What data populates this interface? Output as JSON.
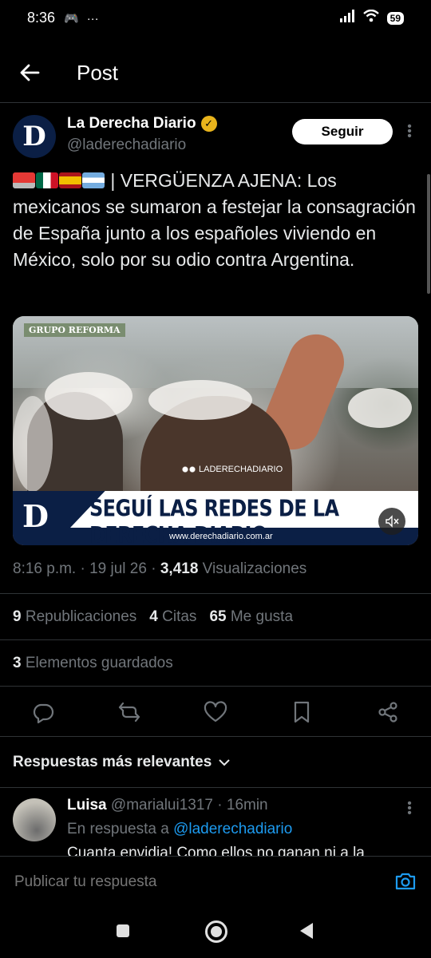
{
  "status_bar": {
    "time": "8:36",
    "extra": "···",
    "battery": "59"
  },
  "header": {
    "title": "Post"
  },
  "author": {
    "name": "La Derecha Diario",
    "handle": "@laderechadiario",
    "avatar_letter": "D",
    "follow_label": "Seguir"
  },
  "tweet": {
    "text": "| VERGÜENZA AJENA: Los mexicanos se sumaron a festejar la consagración de España junto a los españoles viviendo en México, solo por su odio contra Argentina."
  },
  "media": {
    "source_tag": "GRUPO REFORMA",
    "watermark": "LADERECHADIARIO",
    "banner_logo": "D",
    "banner_text": "SEGUÍ LAS REDES DE LA DERECHA DIARIO",
    "banner_url": "www.derechadiario.com.ar"
  },
  "meta": {
    "time": "8:16 p.m.",
    "date": "19 jul 26",
    "views_count": "3,418",
    "views_label": "Visualizaciones"
  },
  "stats": {
    "reposts_count": "9",
    "reposts_label": "Republicaciones",
    "quotes_count": "4",
    "quotes_label": "Citas",
    "likes_count": "65",
    "likes_label": "Me gusta",
    "saved_count": "3",
    "saved_label": "Elementos guardados"
  },
  "replies": {
    "sort_label": "Respuestas más relevantes",
    "first": {
      "name": "Luisa",
      "handle": "@marialui1317",
      "time": "16min",
      "reply_to_prefix": "En respuesta a",
      "reply_to_handle": "@laderechadiario",
      "text": "Cuanta envidia! Como ellos no ganan ni a la"
    }
  },
  "compose": {
    "placeholder": "Publicar tu respuesta"
  },
  "colors": {
    "background": "#000000",
    "text": "#e7e9ea",
    "muted": "#71767b",
    "link": "#1d9bf0",
    "verified": "#e9b41c",
    "divider": "#2f3336"
  }
}
